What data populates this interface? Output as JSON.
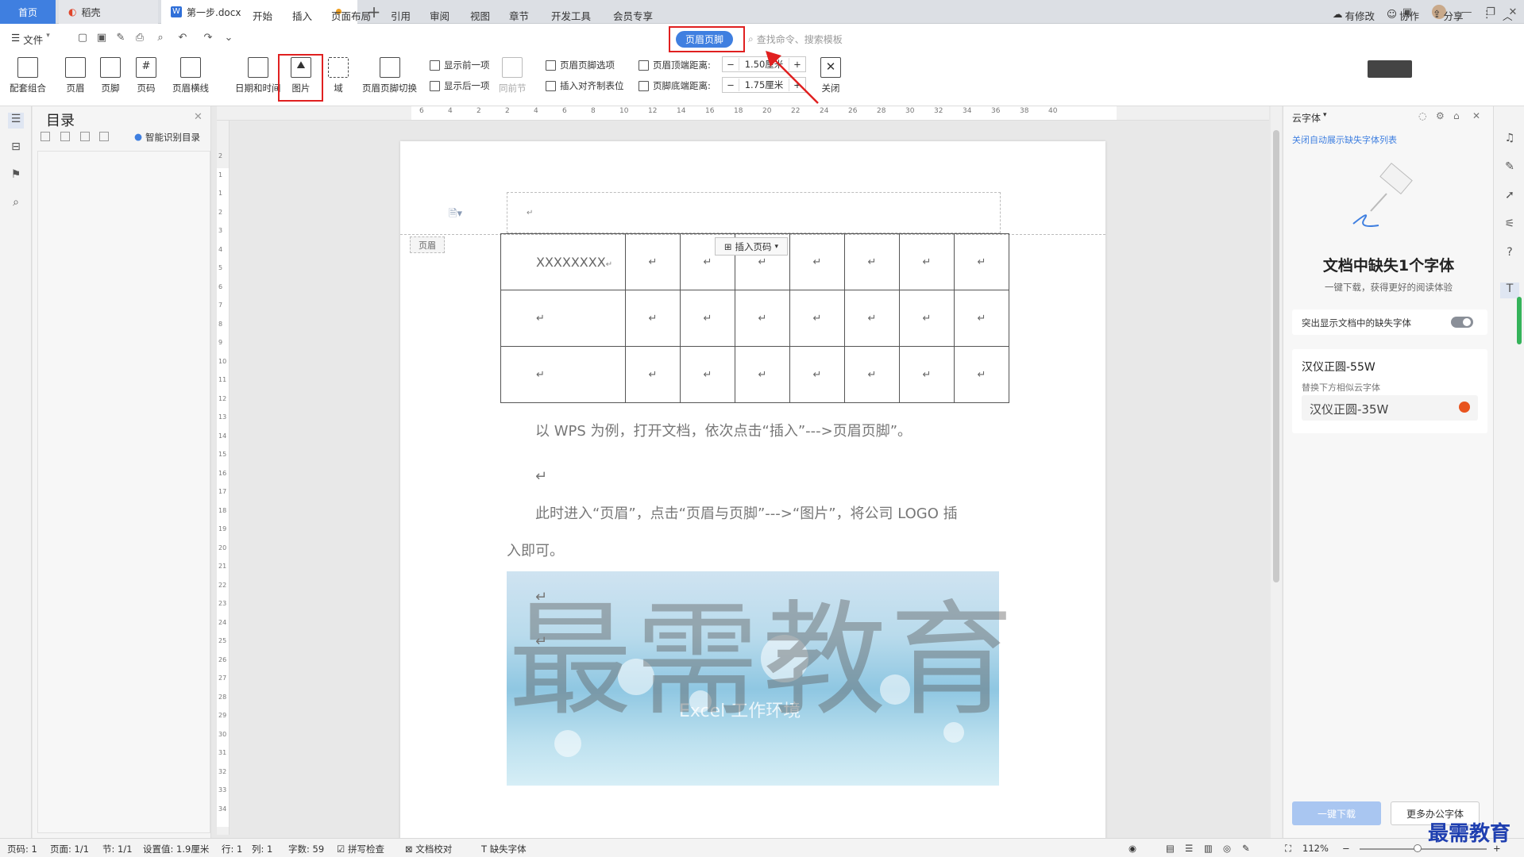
{
  "tabs": {
    "home": "首页",
    "daoke": "稻壳",
    "doc": "第一步.docx",
    "add": "+"
  },
  "menubar": {
    "file": "文件",
    "items": [
      "开始",
      "插入",
      "页面布局",
      "引用",
      "审阅",
      "视图",
      "章节",
      "开发工具",
      "会员专享"
    ],
    "active": "页眉页脚",
    "search": "查找命令、搜索模板",
    "modified": "有修改",
    "collab": "协作",
    "share": "分享"
  },
  "ribbon": {
    "combo": "配套组合",
    "header": "页眉",
    "footer": "页脚",
    "pageno": "页码",
    "hline": "页眉横线",
    "datetime": "日期和时间",
    "picture": "图片",
    "field": "域",
    "switch": "页眉页脚切换",
    "prev": "显示前一项",
    "next": "显示后一项",
    "same": "同前节",
    "options": "页眉页脚选项",
    "align": "插入对齐制表位",
    "top_label": "页眉顶端距离:",
    "top_value": "1.50厘米",
    "bottom_label": "页脚底端距离:",
    "bottom_value": "1.75厘米",
    "close": "关闭",
    "minus": "−",
    "plus": "+"
  },
  "toc": {
    "title": "目录",
    "smart": "智能识别目录"
  },
  "ruler": {
    "h": [
      "6",
      "4",
      "2",
      "2",
      "4",
      "6",
      "8",
      "10",
      "12",
      "14",
      "16",
      "18",
      "20",
      "22",
      "24",
      "26",
      "28",
      "30",
      "32",
      "34",
      "36",
      "38",
      "40"
    ],
    "v": [
      "2",
      "1",
      "1",
      "2",
      "3",
      "4",
      "5",
      "6",
      "7",
      "8",
      "9",
      "10",
      "11",
      "12",
      "13",
      "14",
      "15",
      "16",
      "17",
      "18",
      "19",
      "20",
      "21",
      "22",
      "23",
      "24",
      "25",
      "26",
      "27",
      "28",
      "29",
      "30",
      "31",
      "32",
      "33",
      "34"
    ]
  },
  "doc": {
    "header_tag": "页眉",
    "insert_pagenum": "插入页码",
    "cell1": "XXXXXXXX",
    "para1": "以 WPS 为例，打开文档，依次点击“插入”--->页眉页脚”。",
    "para2a": "此时进入“页眉”，点击“页眉与页脚”--->“图片”，将公司 LOGO 插",
    "para2b": "入即可。",
    "mark": "↵",
    "watermark": "最需教育",
    "banner_text": "Excel 工作环境"
  },
  "panel": {
    "title": "云字体",
    "link": "关闭自动展示缺失字体列表",
    "heading": "文档中缺失1个字体",
    "sub": "一键下载，获得更好的阅读体验",
    "toggle_label": "突出显示文档中的缺失字体",
    "font_missing": "汉仪正圆-55W",
    "replace_hint": "替换下方相似云字体",
    "font_replace": "汉仪正圆-35W",
    "download": "一键下载",
    "more": "更多办公字体"
  },
  "status": {
    "page": "页码: 1",
    "pages": "页面: 1/1",
    "section": "节: 1/1",
    "setting": "设置值: 1.9厘米",
    "row": "行: 1",
    "col": "列: 1",
    "words": "字数: 59",
    "spell": "拼写检查",
    "proof": "文档校对",
    "missing_font": "缺失字体",
    "zoom": "112%"
  },
  "brand": "最需教育",
  "colors": {
    "accent": "#3f7fe0",
    "highlight": "#e02020"
  }
}
